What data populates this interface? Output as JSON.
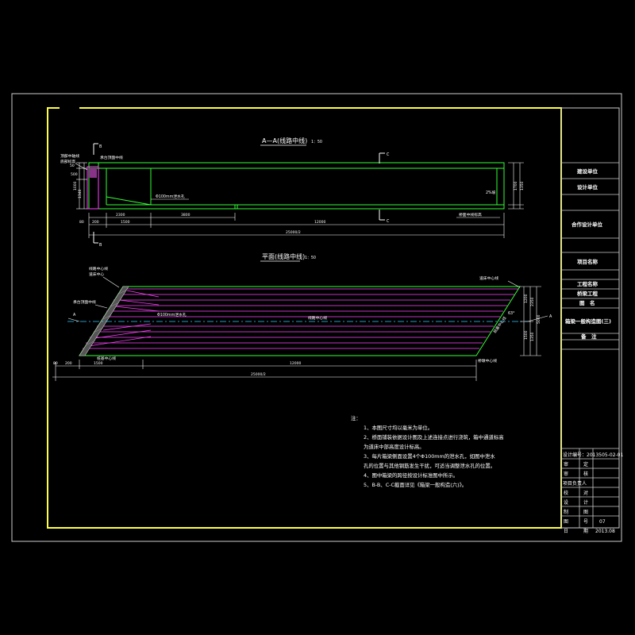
{
  "colors": {
    "background": "#000000",
    "frame": "#ffff44",
    "outline": "#cccccc",
    "concrete": "#33ff33",
    "rebar": "#ff44ff",
    "centerline": "#33ccff",
    "text": "#ffffff"
  },
  "section_view": {
    "title": "A—A(线路中线)",
    "scale": "1：50",
    "cut_b_top": "B",
    "cut_b_bottom": "B",
    "cut_c_top": "C",
    "cut_c_bottom": "C",
    "left_label_1": "顶部中轴线",
    "left_label_2": "底部标高",
    "left_note": "承台顶面中线",
    "pipe_label": "Φ100mm泄水孔",
    "right_label": "桥面中线标高",
    "slope_label": "2%坡",
    "dims": {
      "d1": "50",
      "d2": "500",
      "d3": "1000",
      "d4": "1340",
      "d5": "1500",
      "d6": "2300",
      "d7": "3800",
      "d8": "80",
      "d9": "200",
      "d10": "1500",
      "d11": "12000",
      "d12": "25000/2",
      "r1": "1700",
      "r2": "1350"
    }
  },
  "plan_view": {
    "title": "平面(线路中线)",
    "scale": "1：50",
    "label_top_left_1": "线路中心线",
    "label_top_left_2": "道床中心",
    "label_mid_left": "承台顶面中线",
    "label_bottom_left": "桩基中心线",
    "pipe_label": "Φ100mm泄水孔",
    "center_label": "线路中心线",
    "label_top_right": "道床中心线",
    "label_right_mid": "桩基中心线",
    "label_bottom_right": "桥墩中心线",
    "skew_angle": "63°",
    "dims": {
      "d1": "80",
      "d2": "200",
      "d3": "1500",
      "d4": "12000",
      "d5": "25000/2",
      "r1": "1200",
      "r2": "1500",
      "r3": "5000",
      "r4": "2350",
      "r5": "1350",
      "left_a": "A"
    }
  },
  "notes": {
    "heading": "注：",
    "items": [
      "1、本图尺寸均以毫米为单位。",
      "2、桥面铺装依据设计图及上述连接点进行浇筑，箱中通道标高",
      "   为道床中部高度设计标高。",
      "3、每片箱梁侧面设置4个Φ100mm的泄水孔，如图中泄水",
      "   孔的位置与其他钢筋发生干扰，可适当调整泄水孔的位置。",
      "4、图中箱梁的跨径按设计标准图中所示。",
      "5、B-B、C-C截面详见《箱梁一般构造(六)》。"
    ]
  },
  "title_block": {
    "construction_unit": "建设单位",
    "design_unit": "设计单位",
    "cooperation_unit": "合作设计单位",
    "project_name": "项目名称",
    "engineering_name": "工程名称",
    "sub_project": "桥梁工程",
    "drawing_label": "图　名",
    "drawing_name": "箱梁一般构造图(三)",
    "remarks_label": "备　注",
    "drawing_number": "设计编号：2013505-02-01",
    "rows": [
      {
        "label": "审",
        "sub": "定",
        "value": ""
      },
      {
        "label": "审",
        "sub": "核",
        "value": ""
      },
      {
        "label": "项目负责人",
        "sub": "",
        "value": ""
      },
      {
        "label": "校",
        "sub": "对",
        "value": ""
      },
      {
        "label": "设",
        "sub": "计",
        "value": ""
      },
      {
        "label": "制",
        "sub": "图",
        "value": ""
      },
      {
        "label": "图",
        "sub": "号",
        "value": "07"
      },
      {
        "label": "日",
        "sub": "期",
        "value": "2013.08"
      }
    ]
  }
}
